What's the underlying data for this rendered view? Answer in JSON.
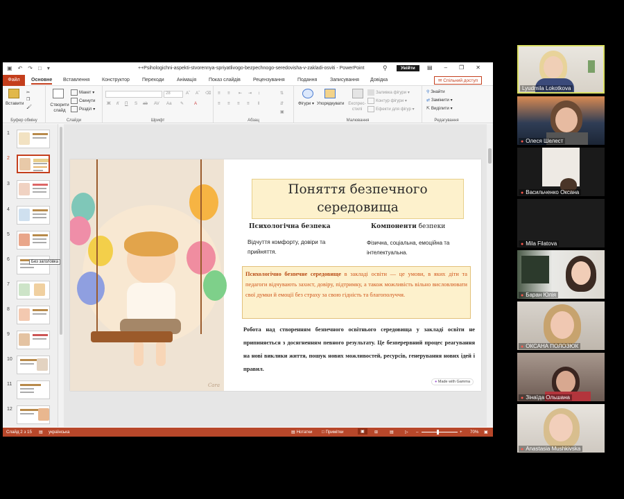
{
  "powerpoint": {
    "title": "++Psihologichni-aspekti-stvorennya-spriyatlivogo-bezpechnogo-seredovisha-v-zakladi-osviti - PowerPoint",
    "sign_in": "Увійти",
    "tabs": [
      "Файл",
      "Основне",
      "Вставлення",
      "Конструктор",
      "Переходи",
      "Анімація",
      "Показ слайдів",
      "Рецензування",
      "Подання",
      "Записування",
      "Довідка"
    ],
    "active_tab": "Основне",
    "share": "Спільний доступ",
    "ribbon": {
      "paste": "Вставити",
      "new_slide": "Створити слайд",
      "layout": "Макет",
      "reset": "Скинути",
      "section": "Розділ",
      "font_size": "28",
      "shapes": "Фігури",
      "arrange": "Упорядкувати",
      "quick_styles": "Експрес-стилі",
      "shape_fill": "Заливка фігури",
      "shape_outline": "Контур фігури",
      "shape_effects": "Ефекти для фігур",
      "find": "Знайти",
      "replace": "Замінити",
      "select": "Виділити",
      "groups": {
        "clipboard": "Буфер обміну",
        "slides": "Слайди",
        "font": "Шрифт",
        "paragraph": "Абзац",
        "drawing": "Малювання",
        "editing": "Редагування"
      }
    },
    "thumbnails": [
      "1",
      "2",
      "3",
      "4",
      "5",
      "6",
      "7",
      "8",
      "9",
      "10",
      "11",
      "12"
    ],
    "selected_slide": 2,
    "tooltip": "Без заголовка",
    "slide": {
      "title_line1": "Поняття безпечного",
      "title_line2": "середовища",
      "col1_heading": "Психологічна безпека",
      "col1_text": "Відчуття комфорту, довіри та прийняття.",
      "col2_heading_bold": "Компоненти",
      "col2_heading_rest": " безпеки",
      "col2_text": "Фізична, соціальна, емоційна та інтелектуальна.",
      "definition_bold": "Психологічно безпечне середовище",
      "definition_rest": " в закладі освіти — це умови, в яких діти та педагоги відчувають захист, довіру, підтримку, а також можливість вільно висловлювати свої думки й емоції без страху за свою гідність та благополуччя.",
      "paragraph": "Робота над створенням безпечного освітнього середовища у закладі освіти не припиняється з досягненням певного результату. Це безперервний процес реагування на нові виклики життя, пошук нових можливостей, ресурсів, генерування нових ідей і правил.",
      "badge": "Made with Gamma"
    },
    "status": {
      "slide_info": "Слайд 2 з 15",
      "language": "українська",
      "notes": "Нотатки",
      "comments": "Примітки",
      "zoom": "70%"
    }
  },
  "participants": [
    {
      "name": "Lyudmila Lokotkova",
      "active": true
    },
    {
      "name": "Олеся Шелест"
    },
    {
      "name": "Васильченко Оксана"
    },
    {
      "name": "Mila Filatova"
    },
    {
      "name": "Баран Юлія"
    },
    {
      "name": "ОКСАНА ПОЛОЗЮК"
    },
    {
      "name": "Зінаїда Ольшана"
    },
    {
      "name": "Anastasia Mushkivska"
    }
  ],
  "colors": {
    "accent": "#c43e1c",
    "status_bar": "#b7472a",
    "title_box": "#fdf1cc",
    "definition_text": "#d0561c"
  }
}
